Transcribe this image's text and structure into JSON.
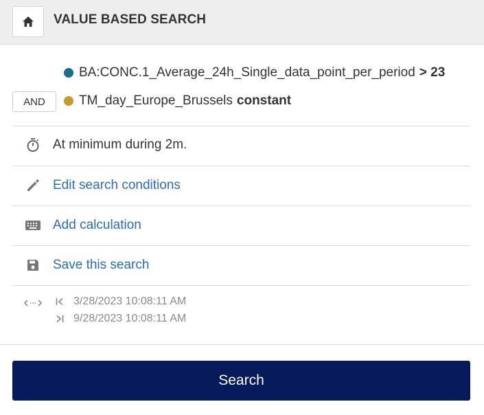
{
  "header": {
    "title": "VALUE BASED SEARCH",
    "home_icon": "home-icon"
  },
  "conditions": [
    {
      "series": "BA:CONC.1_Average_24h_Single_data_point_per_period",
      "operator": "> 23",
      "dot_color": "#1b6e8c"
    },
    {
      "connector": "AND",
      "series": "TM_day_Europe_Brussels",
      "operator": "constant",
      "dot_color": "#c49a2a"
    }
  ],
  "duration": {
    "icon": "stopwatch-icon",
    "text": "At minimum during 2m."
  },
  "actions": [
    {
      "icon": "pencil-icon",
      "label": "Edit search conditions"
    },
    {
      "icon": "keyboard-icon",
      "label": "Add calculation"
    },
    {
      "icon": "save-icon",
      "label": "Save this search"
    }
  ],
  "date_range": {
    "icon": "range-icon",
    "start": "3/28/2023 10:08:11 AM",
    "end": "9/28/2023 10:08:11 AM"
  },
  "search_button": {
    "label": "Search",
    "color": "#071a5b"
  },
  "colors": {
    "link": "#2a6eb7",
    "header_bg": "#eeeeee"
  }
}
